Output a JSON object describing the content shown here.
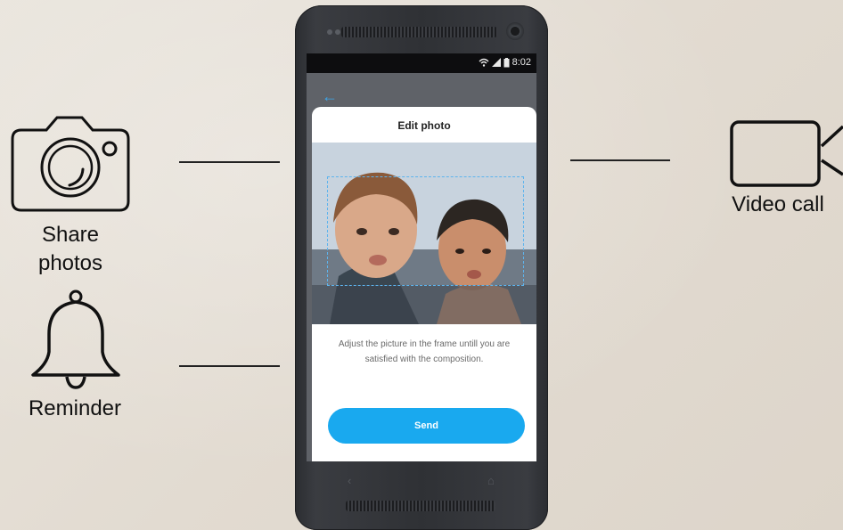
{
  "features": {
    "share_photos": "Share\nphotos",
    "reminder": "Reminder",
    "video_call": "Video call"
  },
  "phone": {
    "status_time": "8:02",
    "sheet_title": "Edit photo",
    "hint": "Adjust the picture in the frame untill you are satisfied with the composition.",
    "send_label": "Send"
  },
  "icons": {
    "camera": "camera-icon",
    "bell": "bell-icon",
    "video": "video-camera-icon",
    "back": "back-arrow-icon"
  },
  "colors": {
    "accent": "#19a9ef",
    "crop_frame": "#5db4ee"
  }
}
